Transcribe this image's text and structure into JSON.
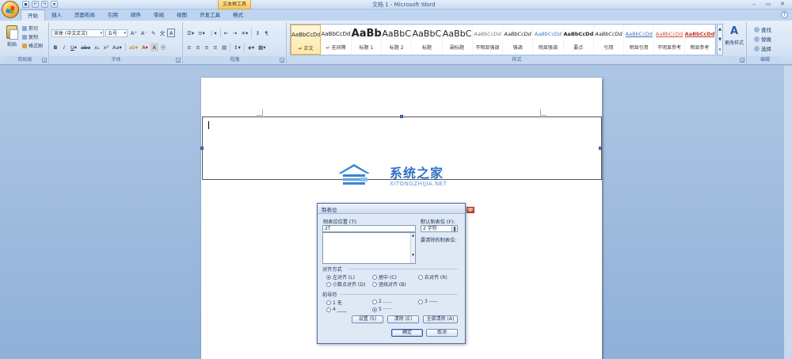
{
  "window": {
    "title": "文档 1 - Microsoft Word",
    "context_tool": "文本框工具",
    "controls": [
      "–",
      "▭",
      "✕"
    ]
  },
  "tabs": [
    {
      "label": "开始",
      "active": true
    },
    {
      "label": "插入"
    },
    {
      "label": "页面布局"
    },
    {
      "label": "引用"
    },
    {
      "label": "邮件"
    },
    {
      "label": "审阅"
    },
    {
      "label": "视图"
    },
    {
      "label": "开发工具"
    },
    {
      "label": "格式"
    }
  ],
  "ribbon": {
    "clipboard": {
      "label": "剪贴板",
      "paste": "粘贴",
      "cut": "剪切",
      "copy": "复制",
      "format_painter": "格式刷"
    },
    "font": {
      "label": "字体",
      "font_name": "宋体 (中文正文)",
      "font_size": "五号"
    },
    "paragraph": {
      "label": "段落"
    },
    "styles": {
      "label": "样式",
      "change_styles": "更改样式",
      "items": [
        {
          "sample": "AaBbCcDd",
          "name": "↵ 正文"
        },
        {
          "sample": "AaBbCcDd",
          "name": "↵ 无间隔"
        },
        {
          "sample": "AaBb",
          "name": "标题 1"
        },
        {
          "sample": "AaBbC",
          "name": "标题 2"
        },
        {
          "sample": "AaBbC",
          "name": "标题"
        },
        {
          "sample": "AaBbC",
          "name": "副标题"
        },
        {
          "sample": "AaBbCcDd",
          "name": "不明显强调"
        },
        {
          "sample": "AaBbCcDd",
          "name": "强调"
        },
        {
          "sample": "AaBbCcDd",
          "name": "明显强调"
        },
        {
          "sample": "AaBbCcDd",
          "name": "要点"
        },
        {
          "sample": "AaBbCcDd",
          "name": "引用"
        },
        {
          "sample": "AaBbCcDd",
          "name": "明显引用"
        },
        {
          "sample": "AaBbCcDd",
          "name": "不明显参考"
        },
        {
          "sample": "AaBbCcDd",
          "name": "明显参考"
        }
      ]
    },
    "editing": {
      "label": "编辑",
      "find": "查找",
      "replace": "替换",
      "select": "选择"
    }
  },
  "watermark": {
    "name": "系统之家",
    "sub": "XITONGZHIJIA.NET"
  },
  "dialog": {
    "title": "制表位",
    "tab_position_label": "制表位位置 (T):",
    "tab_position_value": "2T",
    "default_tab_label": "默认制表位 (F):",
    "default_tab_value": "2 字符",
    "clear_label": "要清除的制表位:",
    "alignment_label": "对齐方式",
    "alignment": [
      "左对齐 (L)",
      "居中 (C)",
      "右对齐 (R)",
      "小数点对齐 (D)",
      "竖线对齐 (B)"
    ],
    "leader_label": "前导符",
    "leader": [
      "1 无",
      "2 ......",
      "3 -----",
      "4 ____",
      "5 ······"
    ],
    "buttons": {
      "set": "设置 (S)",
      "clear": "清除 (E)",
      "clear_all": "全部清除 (A)",
      "ok": "确定",
      "cancel": "取消"
    },
    "help": "?",
    "close": "✕"
  }
}
